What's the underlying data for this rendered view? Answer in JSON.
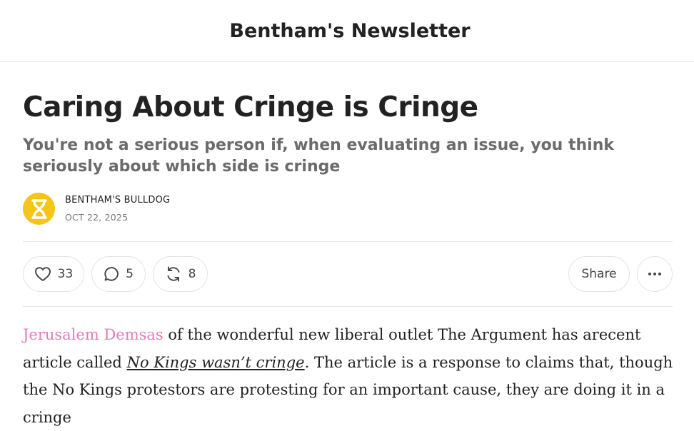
{
  "header": {
    "publication_name": "Bentham's Newsletter"
  },
  "post": {
    "title": "Caring About Cringe is Cringe",
    "subtitle": "You're not a serious person if, when evaluating an issue, you think seriously about which side is cringe",
    "author": "BENTHAM'S BULLDOG",
    "date": "OCT 22, 2025"
  },
  "actions": {
    "like_count": "33",
    "comment_count": "5",
    "restack_count": "8",
    "share_label": "Share",
    "more_icon": "ellipsis-icon"
  },
  "body": {
    "author_link": "Jerusalem Demsas",
    "text_1": " of the wonderful new liberal outlet The Argument has arecent article called ",
    "article_link": "No Kings wasn’t cringe",
    "text_2": ". The article is a response to claims that, though the No Kings protestors are protesting for an important cause, they are doing it in a cringe"
  },
  "colors": {
    "link_pink": "#e879b9",
    "avatar_yellow": "#f5c518",
    "text": "#222222",
    "muted": "#6b6b6b"
  }
}
